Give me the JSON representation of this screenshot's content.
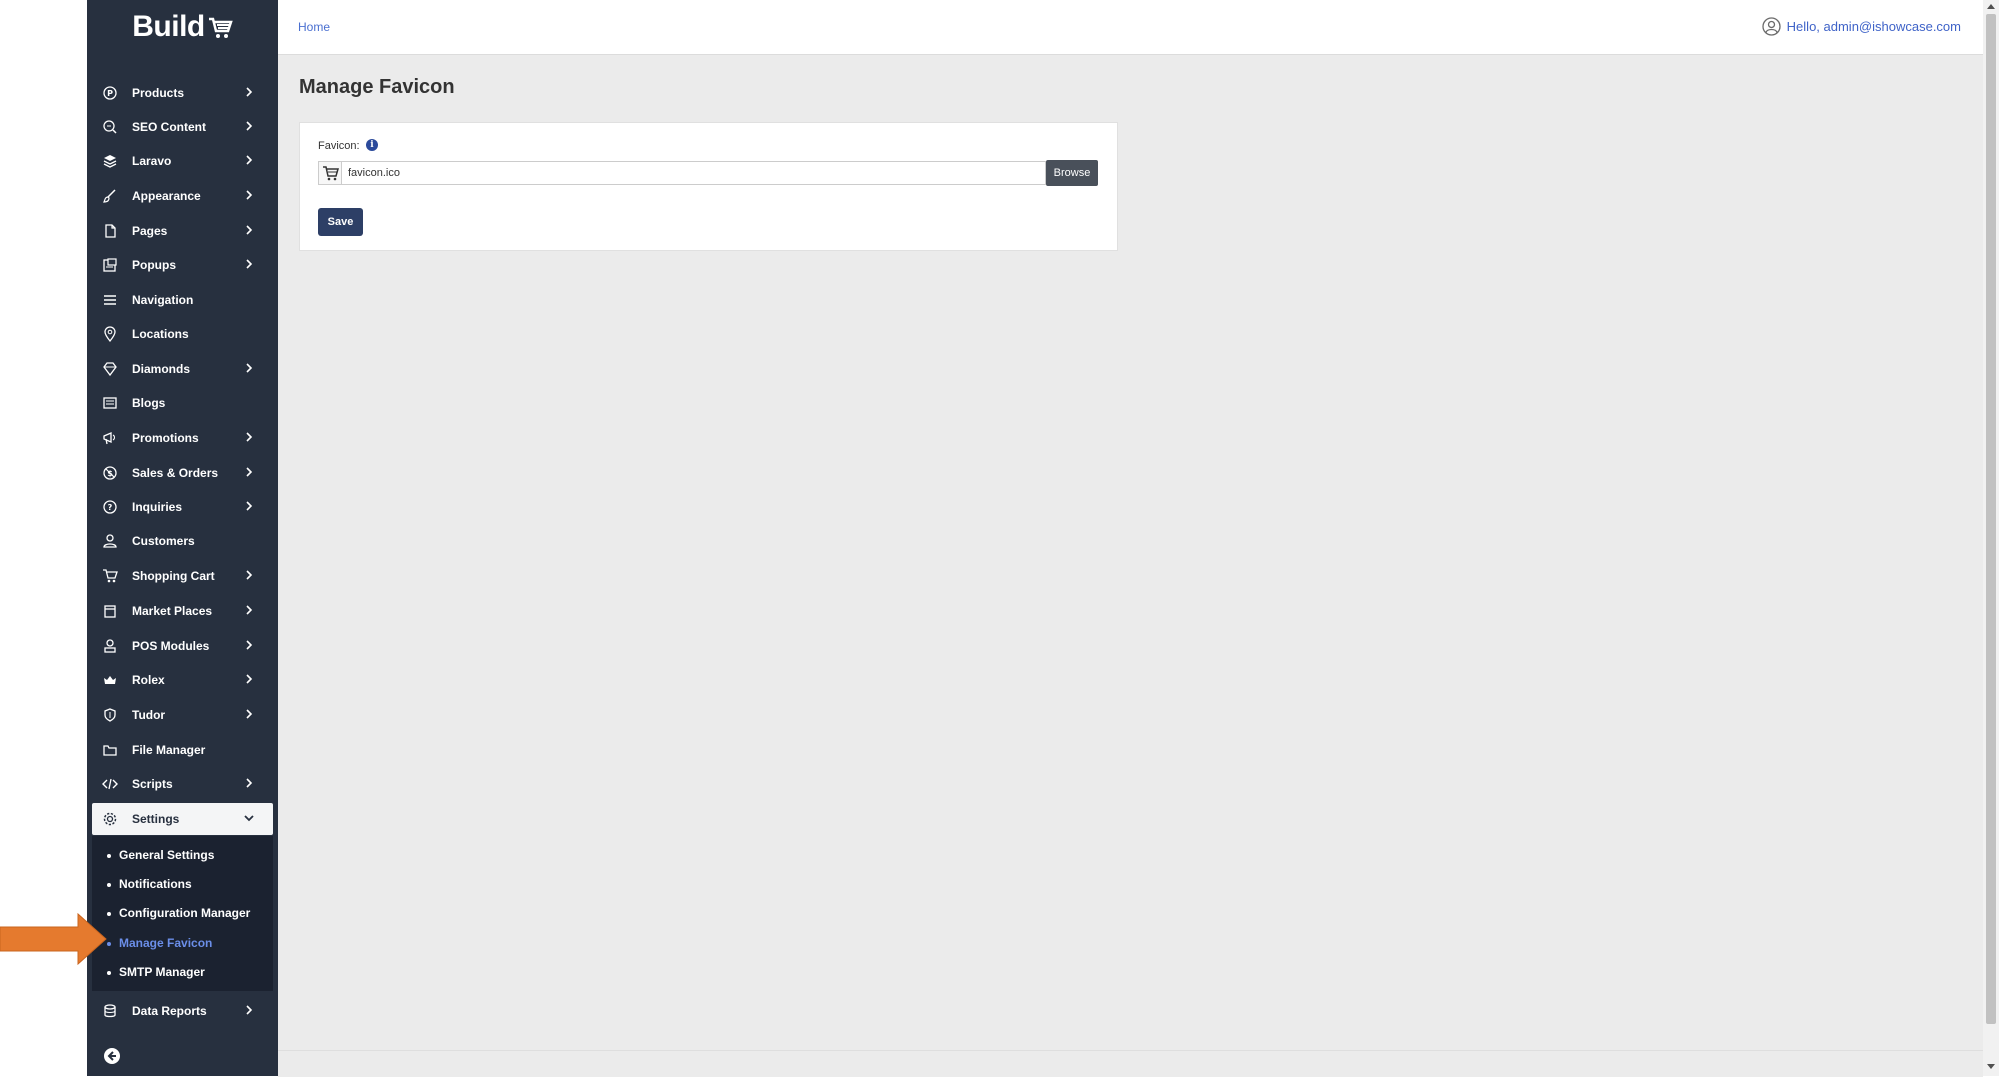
{
  "app": {
    "logo_text": "Build"
  },
  "header": {
    "breadcrumb": "Home",
    "user_greeting": "Hello, admin@ishowcase.com"
  },
  "sidebar": {
    "items": [
      {
        "label": "Products",
        "icon": "tag-icon",
        "chevron": true
      },
      {
        "label": "SEO Content",
        "icon": "seo-search-icon",
        "chevron": true
      },
      {
        "label": "Laravo",
        "icon": "layers-icon",
        "chevron": true
      },
      {
        "label": "Appearance",
        "icon": "brush-icon",
        "chevron": true
      },
      {
        "label": "Pages",
        "icon": "page-icon",
        "chevron": true
      },
      {
        "label": "Popups",
        "icon": "popup-icon",
        "chevron": true
      },
      {
        "label": "Navigation",
        "icon": "menu-lines-icon",
        "chevron": false
      },
      {
        "label": "Locations",
        "icon": "location-pin-icon",
        "chevron": false
      },
      {
        "label": "Diamonds",
        "icon": "diamond-icon",
        "chevron": true
      },
      {
        "label": "Blogs",
        "icon": "blog-icon",
        "chevron": false
      },
      {
        "label": "Promotions",
        "icon": "megaphone-icon",
        "chevron": true
      },
      {
        "label": "Sales & Orders",
        "icon": "dollar-slash-icon",
        "chevron": true
      },
      {
        "label": "Inquiries",
        "icon": "question-icon",
        "chevron": true
      },
      {
        "label": "Customers",
        "icon": "user-icon",
        "chevron": false
      },
      {
        "label": "Shopping Cart",
        "icon": "cart-icon",
        "chevron": true
      },
      {
        "label": "Market Places",
        "icon": "store-icon",
        "chevron": true
      },
      {
        "label": "POS Modules",
        "icon": "pos-icon",
        "chevron": true
      },
      {
        "label": "Rolex",
        "icon": "crown-icon",
        "chevron": true
      },
      {
        "label": "Tudor",
        "icon": "shield-icon",
        "chevron": true
      },
      {
        "label": "File Manager",
        "icon": "folder-icon",
        "chevron": false
      },
      {
        "label": "Scripts",
        "icon": "code-icon",
        "chevron": true
      },
      {
        "label": "Settings",
        "icon": "gear-icon",
        "chevron": true,
        "expanded": true
      }
    ],
    "settings_submenu": [
      {
        "label": "General Settings"
      },
      {
        "label": "Notifications"
      },
      {
        "label": "Configuration Manager"
      },
      {
        "label": "Manage Favicon",
        "current": true
      },
      {
        "label": "SMTP Manager"
      }
    ],
    "bottom_items": [
      {
        "label": "Data Reports",
        "icon": "database-icon",
        "chevron": true
      }
    ]
  },
  "main": {
    "title": "Manage Favicon",
    "form": {
      "favicon_label": "Favicon:",
      "info_symbol": "i",
      "file_value": "favicon.ico",
      "browse_label": "Browse",
      "save_label": "Save"
    }
  },
  "colors": {
    "sidebar_bg": "#27303f",
    "accent": "#2d3f66",
    "link": "#4a6fd0",
    "annotation_arrow": "#e57a2e"
  }
}
